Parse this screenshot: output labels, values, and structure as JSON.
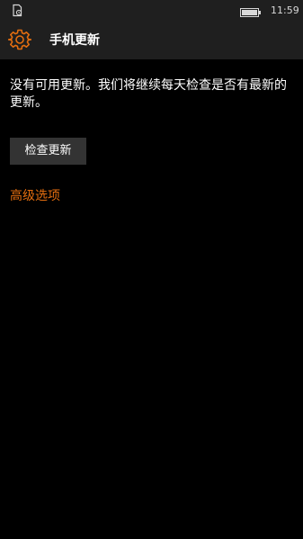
{
  "status_bar": {
    "left_icon": "notification-icon",
    "battery_icon": "battery-icon",
    "time": "11:59"
  },
  "header": {
    "icon": "gear-icon",
    "title": "手机更新"
  },
  "main": {
    "status_message": "没有可用更新。我们将继续每天检查是否有最新的更新。",
    "check_button_label": "检查更新",
    "advanced_link_label": "高级选项"
  },
  "colors": {
    "accent": "#e36d0f",
    "background": "#000000",
    "bar_background": "#1f1f1f",
    "button_background": "#333333",
    "text": "#ffffff"
  }
}
